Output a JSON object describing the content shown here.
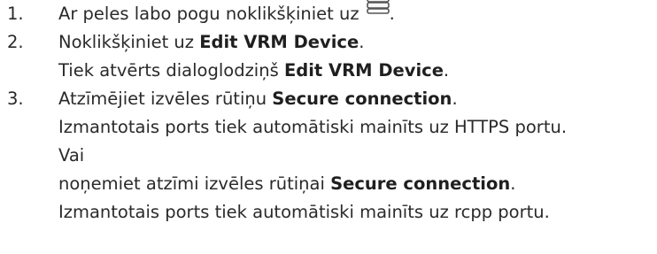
{
  "steps": [
    {
      "number": "1.",
      "text": "Ar peles labo pogu noklikšķiniet uz",
      "icon": "database-icon",
      "suffix": "."
    },
    {
      "number": "2.",
      "prefix": "Noklikšķiniet uz ",
      "bold": "Edit VRM Device",
      "suffix": ".",
      "result_prefix": "Tiek atvērts dialoglodziņš ",
      "result_bold": "Edit VRM Device",
      "result_suffix": "."
    },
    {
      "number": "3.",
      "prefix": "Atzīmējiet izvēles rūtiņu ",
      "bold": "Secure connection",
      "suffix": ".",
      "result1": "Izmantotais ports tiek automātiski mainīts uz HTTPS portu.",
      "or": "Vai",
      "alt_prefix": "noņemiet atzīmi izvēles rūtiņai ",
      "alt_bold": "Secure connection",
      "alt_suffix": ".",
      "result2": "Izmantotais ports tiek automātiski mainīts uz rcpp portu."
    }
  ]
}
